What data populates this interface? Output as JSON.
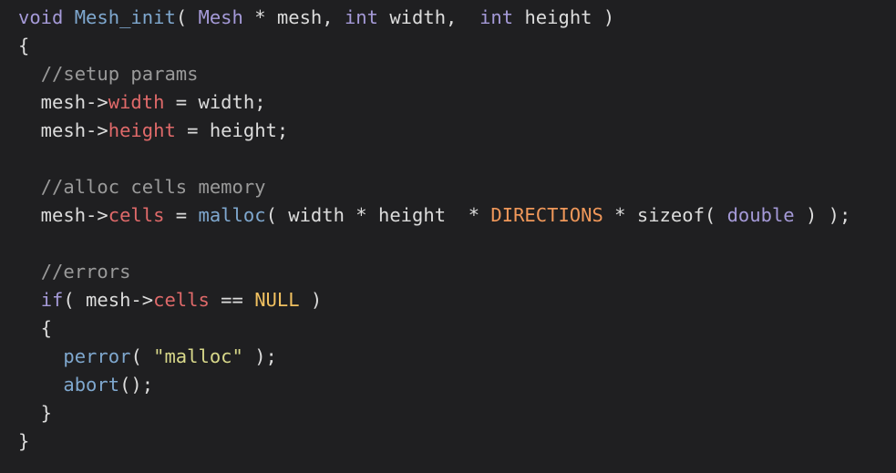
{
  "code": {
    "lines": [
      [
        {
          "t": "void",
          "c": "t-kw"
        },
        {
          "t": " ",
          "c": "t-plain"
        },
        {
          "t": "Mesh_init",
          "c": "t-func"
        },
        {
          "t": "( ",
          "c": "t-plain"
        },
        {
          "t": "Mesh",
          "c": "t-type"
        },
        {
          "t": " * mesh, ",
          "c": "t-plain"
        },
        {
          "t": "int",
          "c": "t-kw"
        },
        {
          "t": " width,  ",
          "c": "t-plain"
        },
        {
          "t": "int",
          "c": "t-kw"
        },
        {
          "t": " height )",
          "c": "t-plain"
        }
      ],
      [
        {
          "t": "{",
          "c": "t-plain"
        }
      ],
      [
        {
          "t": "  ",
          "c": "t-plain"
        },
        {
          "t": "//setup params",
          "c": "t-comment"
        }
      ],
      [
        {
          "t": "  mesh->",
          "c": "t-plain"
        },
        {
          "t": "width",
          "c": "t-field"
        },
        {
          "t": " = width;",
          "c": "t-plain"
        }
      ],
      [
        {
          "t": "  mesh->",
          "c": "t-plain"
        },
        {
          "t": "height",
          "c": "t-field"
        },
        {
          "t": " = height;",
          "c": "t-plain"
        }
      ],
      [
        {
          "t": "",
          "c": "t-plain"
        }
      ],
      [
        {
          "t": "  ",
          "c": "t-plain"
        },
        {
          "t": "//alloc cells memory",
          "c": "t-comment"
        }
      ],
      [
        {
          "t": "  mesh->",
          "c": "t-plain"
        },
        {
          "t": "cells",
          "c": "t-field"
        },
        {
          "t": " = ",
          "c": "t-plain"
        },
        {
          "t": "malloc",
          "c": "t-func"
        },
        {
          "t": "( width * height  * ",
          "c": "t-plain"
        },
        {
          "t": "DIRECTIONS",
          "c": "t-const"
        },
        {
          "t": " * sizeof( ",
          "c": "t-plain"
        },
        {
          "t": "double",
          "c": "t-type"
        },
        {
          "t": " ) );",
          "c": "t-plain"
        }
      ],
      [
        {
          "t": "",
          "c": "t-plain"
        }
      ],
      [
        {
          "t": "  ",
          "c": "t-plain"
        },
        {
          "t": "//errors",
          "c": "t-comment"
        }
      ],
      [
        {
          "t": "  ",
          "c": "t-plain"
        },
        {
          "t": "if",
          "c": "t-kw"
        },
        {
          "t": "( mesh->",
          "c": "t-plain"
        },
        {
          "t": "cells",
          "c": "t-field"
        },
        {
          "t": " == ",
          "c": "t-plain"
        },
        {
          "t": "NULL",
          "c": "t-null"
        },
        {
          "t": " )",
          "c": "t-plain"
        }
      ],
      [
        {
          "t": "  {",
          "c": "t-plain"
        }
      ],
      [
        {
          "t": "    ",
          "c": "t-plain"
        },
        {
          "t": "perror",
          "c": "t-func"
        },
        {
          "t": "( ",
          "c": "t-plain"
        },
        {
          "t": "\"malloc\"",
          "c": "t-str"
        },
        {
          "t": " );",
          "c": "t-plain"
        }
      ],
      [
        {
          "t": "    ",
          "c": "t-plain"
        },
        {
          "t": "abort",
          "c": "t-func"
        },
        {
          "t": "();",
          "c": "t-plain"
        }
      ],
      [
        {
          "t": "  }",
          "c": "t-plain"
        }
      ],
      [
        {
          "t": "}",
          "c": "t-plain"
        }
      ]
    ]
  },
  "colors": {
    "background": "#1f1f21",
    "keyword": "#a59ad8",
    "function": "#7fa8cf",
    "field": "#e06a6a",
    "constant": "#f0985a",
    "null": "#f0c060",
    "string": "#d8d88a",
    "comment": "#9a9a9a",
    "text": "#dcdcdc"
  }
}
